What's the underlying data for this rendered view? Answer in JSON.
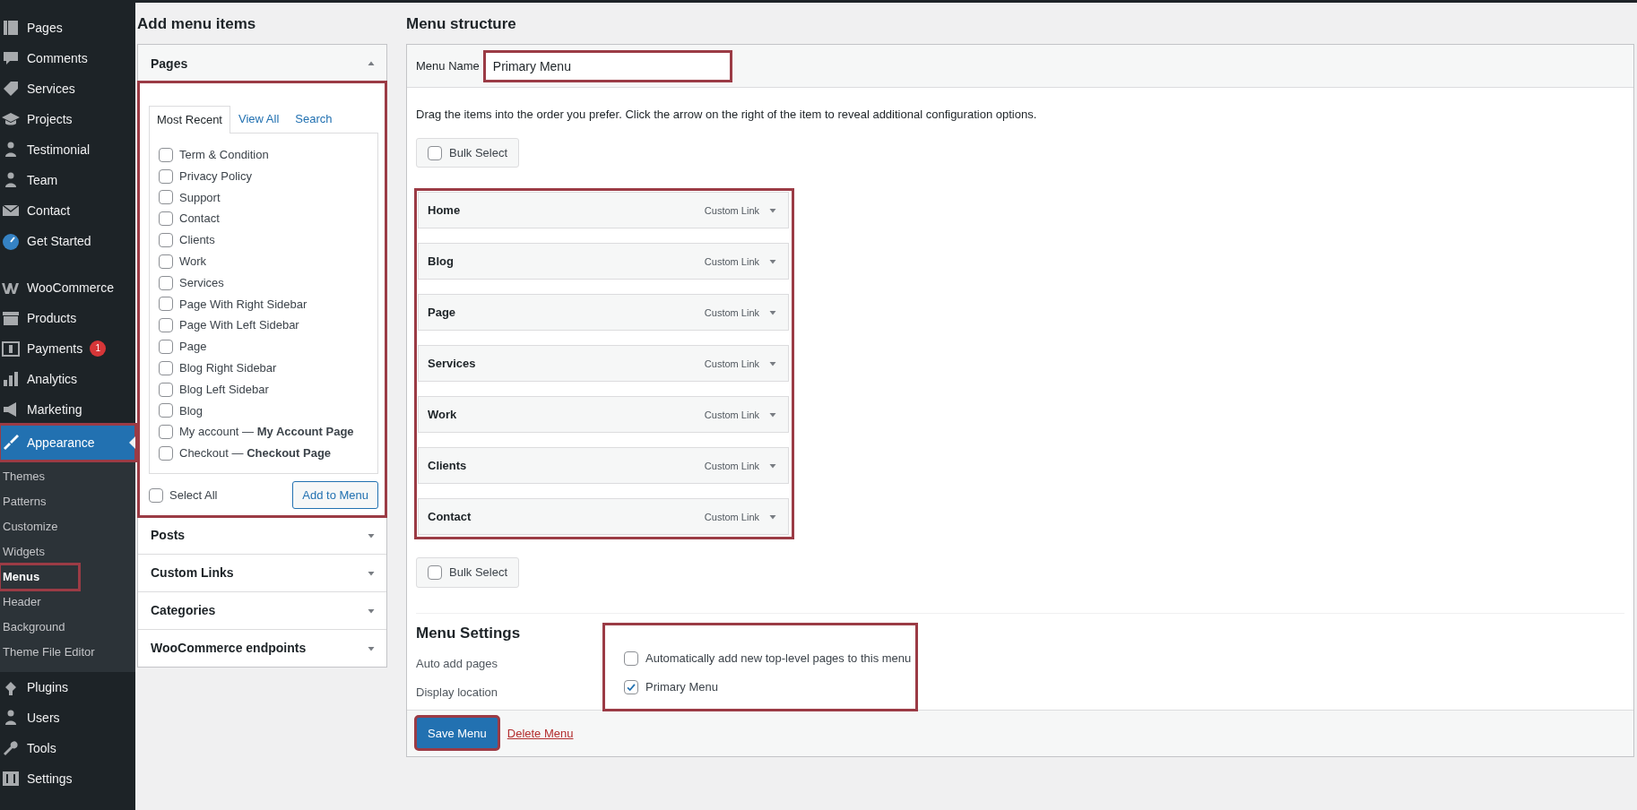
{
  "sidebar": {
    "items": [
      {
        "label": "Pages",
        "selected": false
      },
      {
        "label": "Comments",
        "selected": false
      },
      {
        "label": "Services",
        "selected": false
      },
      {
        "label": "Projects",
        "selected": false
      },
      {
        "label": "Testimonial",
        "selected": false
      },
      {
        "label": "Team",
        "selected": false
      },
      {
        "label": "Contact",
        "selected": false
      },
      {
        "label": "Get Started",
        "selected": false
      },
      {
        "label": "WooCommerce",
        "selected": false
      },
      {
        "label": "Products",
        "selected": false
      },
      {
        "label": "Payments",
        "selected": false,
        "badge": "1"
      },
      {
        "label": "Analytics",
        "selected": false
      },
      {
        "label": "Marketing",
        "selected": false
      },
      {
        "label": "Appearance",
        "selected": true,
        "highlighted": true,
        "children": [
          {
            "label": "Themes",
            "selected": false,
            "highlighted": false
          },
          {
            "label": "Patterns",
            "selected": false,
            "highlighted": false
          },
          {
            "label": "Customize",
            "selected": false,
            "highlighted": false
          },
          {
            "label": "Widgets",
            "selected": false,
            "highlighted": false
          },
          {
            "label": "Menus",
            "selected": true,
            "highlighted": true
          },
          {
            "label": "Header",
            "selected": false,
            "highlighted": false
          },
          {
            "label": "Background",
            "selected": false,
            "highlighted": false
          },
          {
            "label": "Theme File Editor",
            "selected": false,
            "highlighted": false
          }
        ]
      },
      {
        "label": "Plugins",
        "selected": false
      },
      {
        "label": "Users",
        "selected": false
      },
      {
        "label": "Tools",
        "selected": false
      },
      {
        "label": "Settings",
        "selected": false
      }
    ]
  },
  "add_menu_items": {
    "title": "Add menu items",
    "sections": [
      {
        "title": "Pages",
        "expanded": true,
        "highlighted": true,
        "tabs": [
          {
            "label": "Most Recent",
            "selected": true
          },
          {
            "label": "View All",
            "selected": false
          },
          {
            "label": "Search",
            "selected": false
          }
        ],
        "pages": [
          {
            "label": "Term & Condition",
            "checked": false
          },
          {
            "label": "Privacy Policy",
            "checked": false
          },
          {
            "label": "Support",
            "checked": false
          },
          {
            "label": "Contact",
            "checked": false
          },
          {
            "label": "Clients",
            "checked": false
          },
          {
            "label": "Work",
            "checked": false
          },
          {
            "label": "Services",
            "checked": false
          },
          {
            "label": "Page With Right Sidebar",
            "checked": false
          },
          {
            "label": "Page With Left Sidebar",
            "checked": false
          },
          {
            "label": "Page",
            "checked": false
          },
          {
            "label": "Blog Right Sidebar",
            "checked": false
          },
          {
            "label": "Blog Left Sidebar",
            "checked": false
          },
          {
            "label": "Blog",
            "checked": false
          },
          {
            "label": "My account — **My Account Page**",
            "checked": false
          },
          {
            "label": "Checkout — **Checkout Page**",
            "checked": false
          }
        ],
        "select_all": {
          "label": "Select All",
          "checked": false
        },
        "add_button": "Add to Menu"
      },
      {
        "title": "Posts",
        "expanded": false
      },
      {
        "title": "Custom Links",
        "expanded": false
      },
      {
        "title": "Categories",
        "expanded": false
      },
      {
        "title": "WooCommerce endpoints",
        "expanded": false
      }
    ]
  },
  "menu_structure": {
    "title": "Menu structure",
    "menu_name": {
      "label": "Menu Name",
      "value": "Primary Menu",
      "highlighted": true
    },
    "instructions": "Drag the items into the order you prefer. Click the arrow on the right of the item to reveal additional configuration options.",
    "bulk_select_top": {
      "label": "Bulk Select",
      "checked": false
    },
    "items_highlighted": true,
    "items": [
      {
        "title": "Home",
        "type": "Custom Link"
      },
      {
        "title": "Blog",
        "type": "Custom Link"
      },
      {
        "title": "Page",
        "type": "Custom Link"
      },
      {
        "title": "Services",
        "type": "Custom Link"
      },
      {
        "title": "Work",
        "type": "Custom Link"
      },
      {
        "title": "Clients",
        "type": "Custom Link"
      },
      {
        "title": "Contact",
        "type": "Custom Link"
      }
    ],
    "bulk_select_bottom": {
      "label": "Bulk Select",
      "checked": false
    },
    "settings": {
      "title": "Menu Settings",
      "highlighted": true,
      "rows": [
        {
          "label": "Auto add pages",
          "option": "Automatically add new top-level pages to this menu",
          "checked": false
        },
        {
          "label": "Display location",
          "option": "Primary Menu",
          "checked": true
        }
      ]
    },
    "save_button": {
      "label": "Save Menu",
      "highlighted": true
    },
    "delete_link": "Delete Menu"
  }
}
